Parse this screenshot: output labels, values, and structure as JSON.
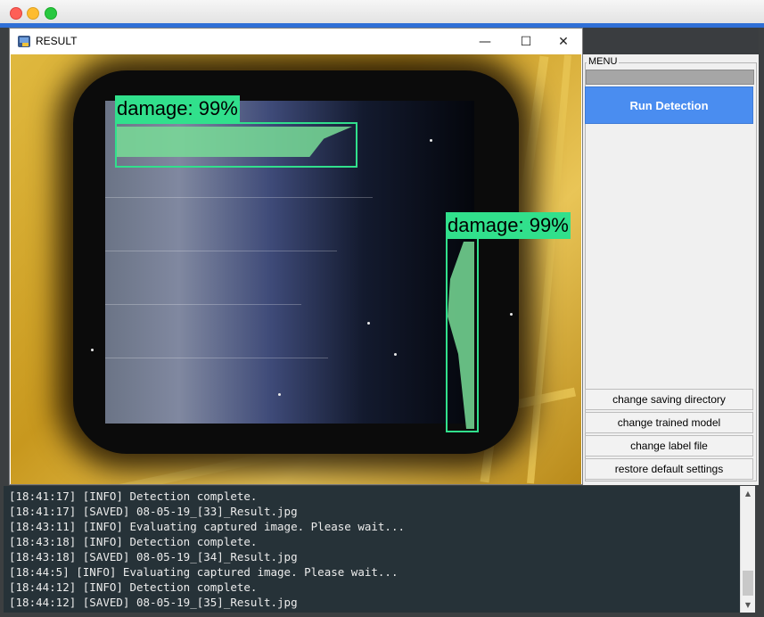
{
  "result_window": {
    "title": "RESULT",
    "icon": "python-app-icon",
    "controls": {
      "minimize": "—",
      "maximize": "☐",
      "close": "✕"
    },
    "detections": [
      {
        "label": "damage: 99%"
      },
      {
        "label": "damage: 99%"
      }
    ]
  },
  "menu": {
    "legend": "MENU",
    "run_button": "Run Detection",
    "buttons": [
      "change saving directory",
      "change trained model",
      "change label file",
      "restore default settings"
    ]
  },
  "log": {
    "lines": [
      "[18:41:17] [INFO] Detection complete.",
      "[18:41:17] [SAVED] 08-05-19_[33]_Result.jpg",
      "[18:43:11] [INFO] Evaluating captured image. Please wait...",
      "[18:43:18] [INFO] Detection complete.",
      "[18:43:18] [SAVED] 08-05-19_[34]_Result.jpg",
      "[18:44:5] [INFO] Evaluating captured image. Please wait...",
      "[18:44:12] [INFO] Detection complete.",
      "[18:44:12] [SAVED] 08-05-19_[35]_Result.jpg"
    ]
  },
  "colors": {
    "detection": "#31e08c",
    "run_button": "#4a8df0",
    "log_background": "#263238",
    "accent": "#2f6fd6"
  }
}
